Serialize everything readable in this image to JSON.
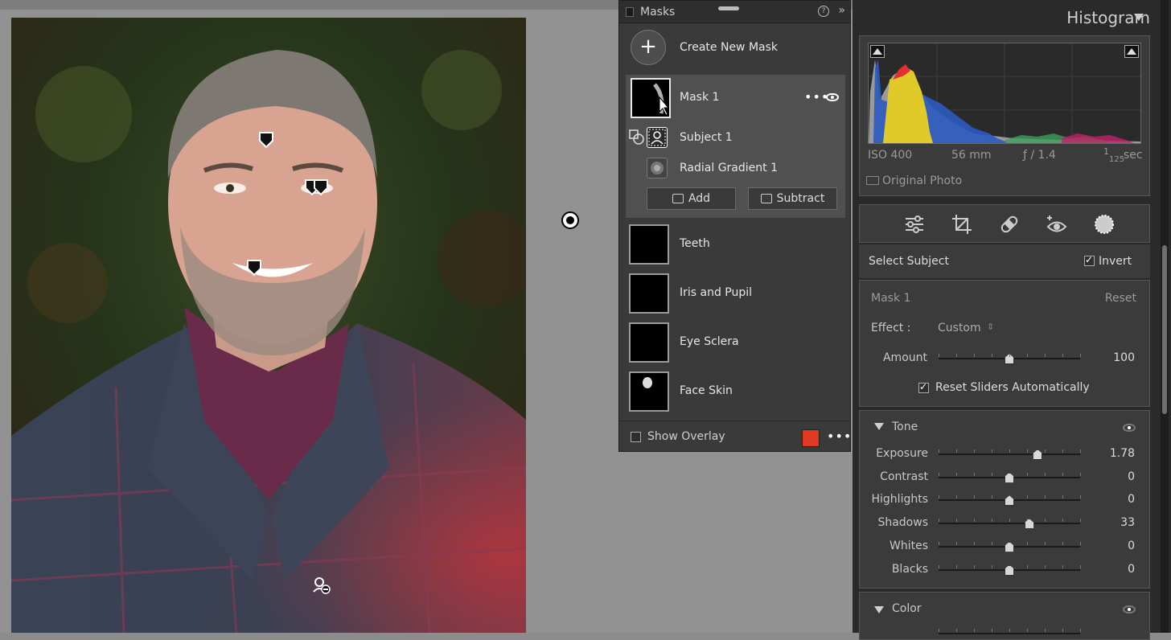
{
  "masks_panel": {
    "title": "Masks",
    "help": "?",
    "collapse": "»",
    "create_label": "Create New Mask",
    "mask1": {
      "name": "Mask 1",
      "menu": "•••"
    },
    "components": [
      {
        "name": "Subject 1"
      },
      {
        "name": "Radial Gradient 1"
      }
    ],
    "add_label": "Add",
    "subtract_label": "Subtract",
    "other_masks": [
      {
        "name": "Teeth"
      },
      {
        "name": "Iris and Pupil"
      },
      {
        "name": "Eye Sclera"
      },
      {
        "name": "Face Skin"
      }
    ],
    "show_overlay_label": "Show Overlay",
    "overlay_color": "#e03a22",
    "footer_menu": "•••"
  },
  "histogram": {
    "title": "Histogram",
    "iso": "ISO 400",
    "focal": "56 mm",
    "aperture": "ƒ / 1.4",
    "shutter_num": "1",
    "shutter_den": "125",
    "shutter_unit": "sec",
    "original_photo_label": "Original Photo"
  },
  "select_row": {
    "label": "Select Subject",
    "invert_label": "Invert",
    "invert_checked": true
  },
  "mask_settings": {
    "name": "Mask 1",
    "reset_label": "Reset",
    "effect_label": "Effect :",
    "effect_value": "Custom",
    "amount_label": "Amount",
    "amount_value": "100",
    "amount_fraction": 0.5,
    "reset_sliders_label": "Reset Sliders Automatically",
    "reset_sliders_checked": true
  },
  "tone": {
    "title": "Tone",
    "sliders": [
      {
        "label": "Exposure",
        "value": "1.78",
        "fraction": 0.7
      },
      {
        "label": "Contrast",
        "value": "0",
        "fraction": 0.5
      },
      {
        "label": "Highlights",
        "value": "0",
        "fraction": 0.5
      },
      {
        "label": "Shadows",
        "value": "33",
        "fraction": 0.64
      },
      {
        "label": "Whites",
        "value": "0",
        "fraction": 0.5
      },
      {
        "label": "Blacks",
        "value": "0",
        "fraction": 0.5
      }
    ]
  },
  "color": {
    "title": "Color"
  }
}
